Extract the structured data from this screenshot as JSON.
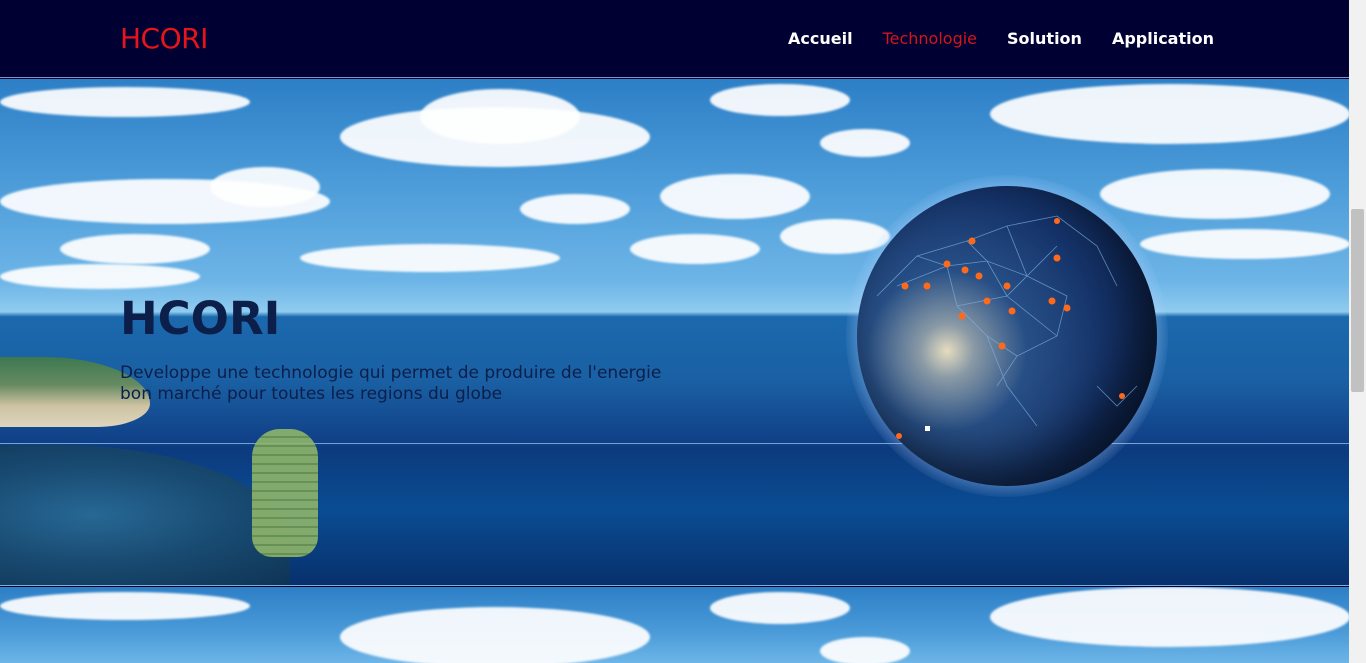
{
  "navbar": {
    "brand": "HCORI",
    "links": [
      {
        "label": "Accueil",
        "active": false
      },
      {
        "label": "Technologie",
        "active": true
      },
      {
        "label": "Solution",
        "active": false
      },
      {
        "label": "Application",
        "active": false
      }
    ]
  },
  "hero": {
    "title": "HCORI",
    "description": "Developpe une technologie qui permet de produire de l'energie bon marché pour toutes les regions du globe"
  },
  "colors": {
    "navbar_bg": "#010033",
    "brand": "#e8141c",
    "active_link": "#d3161c",
    "hero_text": "#0c1f4a"
  },
  "icons": [
    "globe-icon",
    "buoy-icon",
    "island-icon"
  ]
}
